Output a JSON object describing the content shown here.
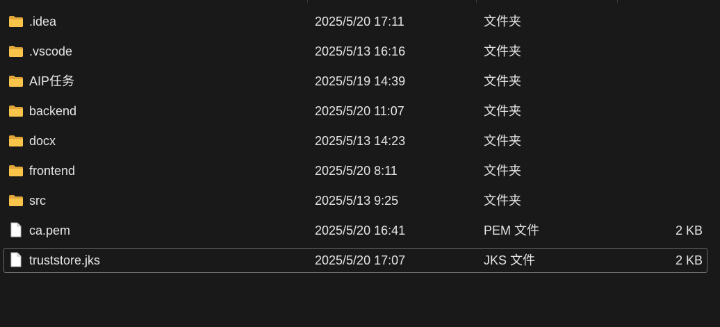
{
  "rows": [
    {
      "name": ".idea",
      "date": "2025/5/20 17:11",
      "type": "文件夹",
      "size": "",
      "icon": "folder-icon"
    },
    {
      "name": ".vscode",
      "date": "2025/5/13 16:16",
      "type": "文件夹",
      "size": "",
      "icon": "folder-icon"
    },
    {
      "name": "AIP任务",
      "date": "2025/5/19 14:39",
      "type": "文件夹",
      "size": "",
      "icon": "folder-icon"
    },
    {
      "name": "backend",
      "date": "2025/5/20 11:07",
      "type": "文件夹",
      "size": "",
      "icon": "folder-icon"
    },
    {
      "name": "docx",
      "date": "2025/5/13 14:23",
      "type": "文件夹",
      "size": "",
      "icon": "folder-icon"
    },
    {
      "name": "frontend",
      "date": "2025/5/20 8:11",
      "type": "文件夹",
      "size": "",
      "icon": "folder-icon"
    },
    {
      "name": "src",
      "date": "2025/5/13 9:25",
      "type": "文件夹",
      "size": "",
      "icon": "folder-icon"
    },
    {
      "name": "ca.pem",
      "date": "2025/5/20 16:41",
      "type": "PEM 文件",
      "size": "2 KB",
      "icon": "file-icon"
    },
    {
      "name": "truststore.jks",
      "date": "2025/5/20 17:07",
      "type": "JKS 文件",
      "size": "2 KB",
      "icon": "file-icon",
      "selected": true
    }
  ],
  "colors": {
    "background": "#191919",
    "text": "#e6e6e6",
    "folder": "#f8c44a",
    "selection_border": "#6a6a6a"
  }
}
